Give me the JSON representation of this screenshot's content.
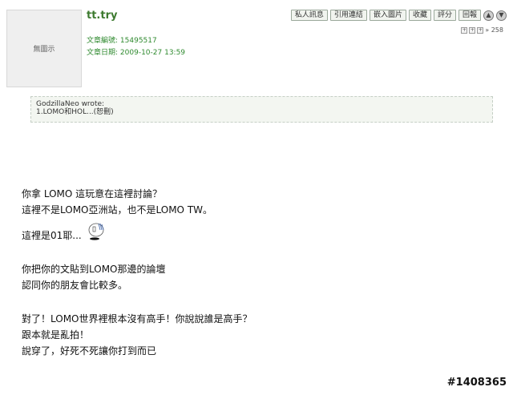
{
  "avatar": {
    "placeholder_text": "無圖示"
  },
  "author": {
    "name": "tt.try"
  },
  "meta": {
    "post_id_label": "文章編號:",
    "post_id": "15495517",
    "date_label": "文章日期:",
    "date": "2009-10-27 13:59"
  },
  "toolbar": {
    "buttons": [
      "私人訊息",
      "引用連結",
      "嵌入圖片",
      "收藏",
      "評分",
      "回報"
    ],
    "round_icons": [
      "arrow-up-icon",
      "arrow-down-icon"
    ]
  },
  "mini_row": {
    "count_label": "» 258"
  },
  "quote": {
    "author_line": "GodzillaNeo wrote:",
    "text": "1.LOMO和HOL...(恕刪)"
  },
  "body": {
    "line1": "你拿 LOMO 這玩意在這裡討論？",
    "line2": "這裡不是LOMO亞洲站，也不是LOMO TW。",
    "line3": "這裡是01耶...",
    "line4": "你把你的文貼到LOMO那邊的論壇",
    "line5": "認同你的朋友會比較多。",
    "line6": "對了！LOMO世界裡根本沒有高手！你說說誰是高手？",
    "line7": "跟本就是亂拍！",
    "line8": "說穿了，好死不死讓你打到而已"
  },
  "watermark": {
    "text": "#1408365"
  },
  "colors": {
    "author": "#3d7a2f",
    "meta": "#2f8a2f",
    "quote_bg": "#f3f6f1"
  }
}
